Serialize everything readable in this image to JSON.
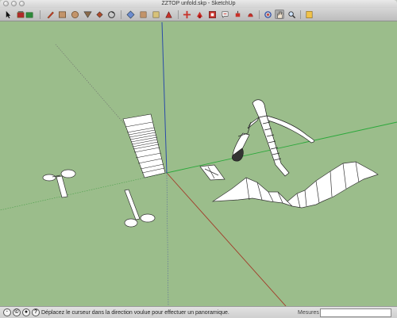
{
  "window": {
    "title": "ZZTOP unfold.skp - SketchUp"
  },
  "toolbar": {
    "tools": [
      {
        "name": "select-tool",
        "icon": "arrow-cursor-icon"
      },
      {
        "name": "make-component-tool",
        "icon": "component-icon"
      },
      {
        "name": "paint-tool",
        "icon": "paint-bucket-icon"
      },
      {
        "name": "pencil-tool",
        "icon": "pencil-icon"
      },
      {
        "name": "rectangle-tool",
        "icon": "rectangle-icon"
      },
      {
        "name": "circle-tool",
        "icon": "circle-icon"
      },
      {
        "name": "push-pull-tool",
        "icon": "push-pull-icon"
      },
      {
        "name": "rotate-tool",
        "icon": "rotate-icon"
      },
      {
        "name": "offset-tool",
        "icon": "offset-icon"
      },
      {
        "name": "tape-tool",
        "icon": "tape-icon"
      },
      {
        "name": "eraser-tool",
        "icon": "eraser-icon"
      },
      {
        "name": "move-tool",
        "icon": "move-icon"
      },
      {
        "name": "orbit-tool",
        "icon": "orbit-icon"
      },
      {
        "name": "pan-tool",
        "icon": "hand-icon"
      },
      {
        "name": "zoom-tool",
        "icon": "magnifier-icon"
      },
      {
        "name": "warehouse-tool",
        "icon": "warehouse-icon"
      }
    ],
    "active_tool": "pan-tool"
  },
  "status": {
    "message": "Déplacez le curseur dans la direction voulue pour effectuer un panoramique.",
    "measures_label": "Mesures",
    "measures_value": ""
  },
  "colors": {
    "viewport_bg": "#9bbd8b",
    "axis_red": "#a23b2a",
    "axis_green": "#2aa83a",
    "axis_blue": "#2a4ba8"
  }
}
